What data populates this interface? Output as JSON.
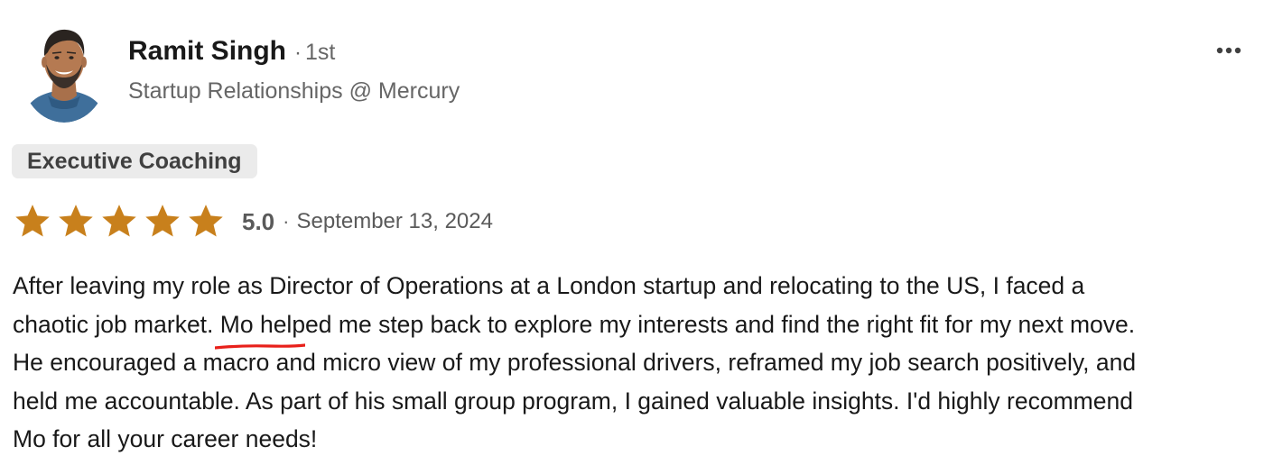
{
  "reviewer": {
    "name": "Ramit Singh",
    "separator": "·",
    "connection_degree": "1st",
    "headline": "Startup Relationships @ Mercury"
  },
  "more_menu": {
    "icon": "more-horizontal-icon"
  },
  "service_tag": "Executive Coaching",
  "rating": {
    "stars": 5,
    "max_stars": 5,
    "score_text": "5.0",
    "separator": "·",
    "date": "September 13, 2024",
    "star_color": "#c8801c"
  },
  "review": {
    "line1": "After leaving my role as Director of Operations at a London startup and relocating to the US, I faced a",
    "line2_before": "chaotic job market.",
    "line2_highlight": "Mo helped me step back to explore my interests and find the right fit for my next move.",
    "line3": "He encouraged a macro and micro view of my professional drivers, reframed my job search positively, and",
    "line4": "held me accountable. As part of his small group program, I gained valuable insights. I'd highly recommend",
    "line5": "Mo for all your career needs!",
    "highlight_color": "#e8201a"
  }
}
